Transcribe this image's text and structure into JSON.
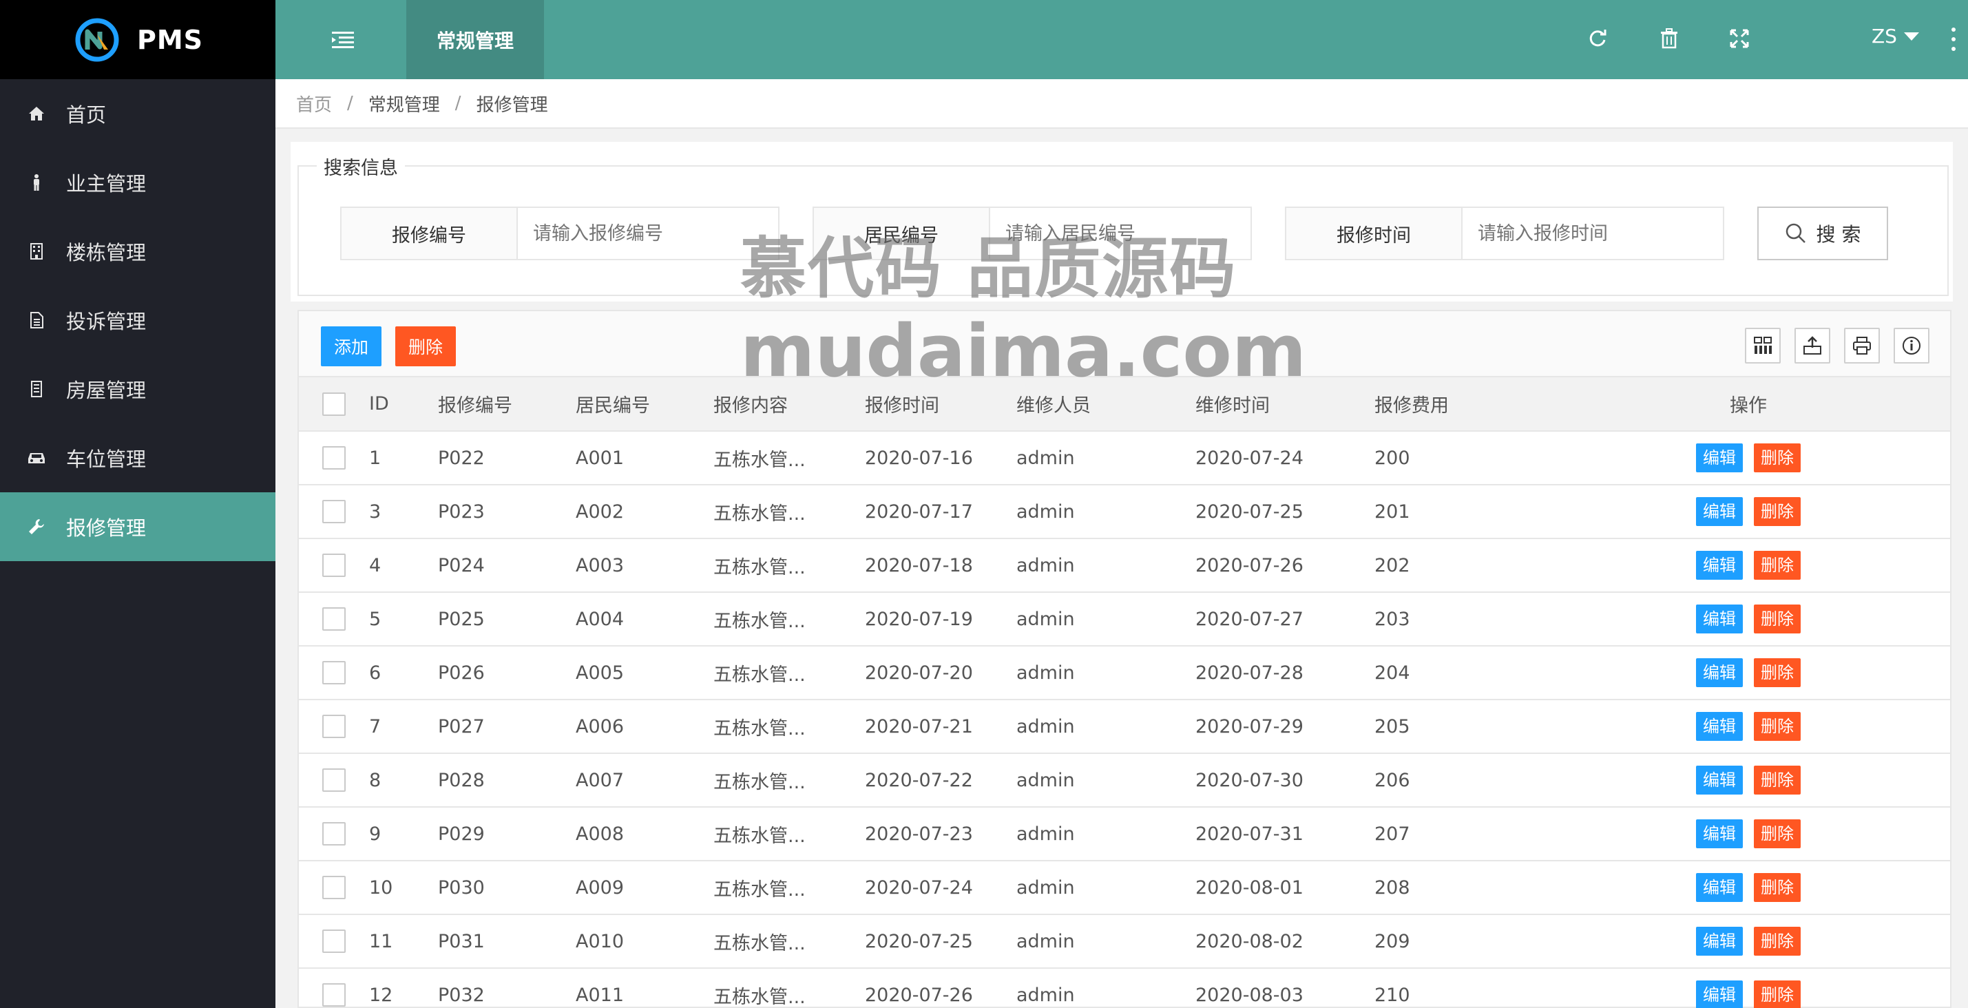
{
  "app": {
    "logo_text": "PMS"
  },
  "sidebar": {
    "items": [
      {
        "label": "首页",
        "icon": "home-icon"
      },
      {
        "label": "业主管理",
        "icon": "person-icon"
      },
      {
        "label": "楼栋管理",
        "icon": "building-icon"
      },
      {
        "label": "投诉管理",
        "icon": "document-icon"
      },
      {
        "label": "房屋管理",
        "icon": "house-icon"
      },
      {
        "label": "车位管理",
        "icon": "car-icon"
      },
      {
        "label": "报修管理",
        "icon": "wrench-icon",
        "active": true
      }
    ]
  },
  "header": {
    "tab_label": "常规管理",
    "user": "ZS"
  },
  "breadcrumb": {
    "home": "首页",
    "section": "常规管理",
    "current": "报修管理"
  },
  "search": {
    "legend": "搜索信息",
    "repair_no_label": "报修编号",
    "repair_no_placeholder": "请输入报修编号",
    "resident_no_label": "居民编号",
    "resident_no_placeholder": "请输入居民编号",
    "repair_time_label": "报修时间",
    "repair_time_placeholder": "请输入报修时间",
    "button_label": "搜 索"
  },
  "toolbar": {
    "add_label": "添加",
    "delete_label": "删除"
  },
  "table": {
    "headers": [
      "ID",
      "报修编号",
      "居民编号",
      "报修内容",
      "报修时间",
      "维修人员",
      "维修时间",
      "报修费用",
      "操作"
    ],
    "edit_label": "编辑",
    "delete_label": "删除",
    "rows": [
      [
        "1",
        "P022",
        "A001",
        "五栋水管...",
        "2020-07-16",
        "admin",
        "2020-07-24",
        "200"
      ],
      [
        "3",
        "P023",
        "A002",
        "五栋水管...",
        "2020-07-17",
        "admin",
        "2020-07-25",
        "201"
      ],
      [
        "4",
        "P024",
        "A003",
        "五栋水管...",
        "2020-07-18",
        "admin",
        "2020-07-26",
        "202"
      ],
      [
        "5",
        "P025",
        "A004",
        "五栋水管...",
        "2020-07-19",
        "admin",
        "2020-07-27",
        "203"
      ],
      [
        "6",
        "P026",
        "A005",
        "五栋水管...",
        "2020-07-20",
        "admin",
        "2020-07-28",
        "204"
      ],
      [
        "7",
        "P027",
        "A006",
        "五栋水管...",
        "2020-07-21",
        "admin",
        "2020-07-29",
        "205"
      ],
      [
        "8",
        "P028",
        "A007",
        "五栋水管...",
        "2020-07-22",
        "admin",
        "2020-07-30",
        "206"
      ],
      [
        "9",
        "P029",
        "A008",
        "五栋水管...",
        "2020-07-23",
        "admin",
        "2020-07-31",
        "207"
      ],
      [
        "10",
        "P030",
        "A009",
        "五栋水管...",
        "2020-07-24",
        "admin",
        "2020-08-01",
        "208"
      ],
      [
        "11",
        "P031",
        "A010",
        "五栋水管...",
        "2020-07-25",
        "admin",
        "2020-08-02",
        "209"
      ],
      [
        "12",
        "P032",
        "A011",
        "五栋水管...",
        "2020-07-26",
        "admin",
        "2020-08-03",
        "210"
      ]
    ]
  },
  "watermark": {
    "line1": "慕代码 品质源码",
    "line2": "mudaima.com"
  },
  "colors": {
    "sidebar": "#20222a",
    "accent": "#4ea297",
    "blue": "#1e9fff",
    "orange": "#ff5722"
  }
}
